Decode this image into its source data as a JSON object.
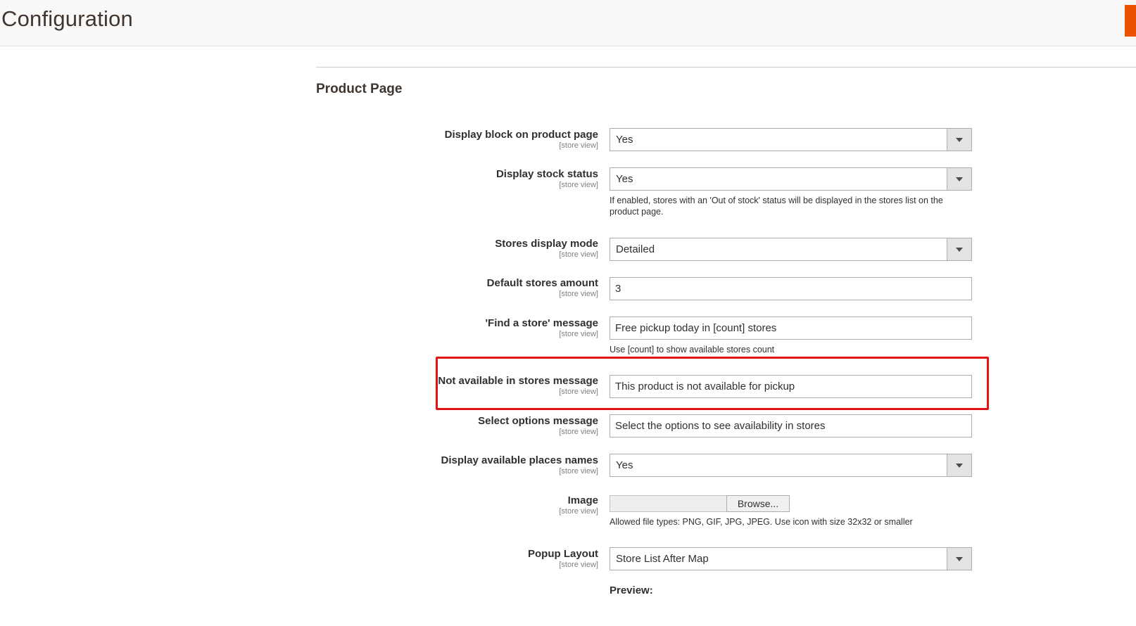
{
  "page": {
    "title": "Configuration"
  },
  "section": {
    "title": "Product Page"
  },
  "scope_text": "[store view]",
  "fields": {
    "display_block": {
      "label": "Display block on product page",
      "value": "Yes"
    },
    "display_stock": {
      "label": "Display stock status",
      "value": "Yes",
      "note": "If enabled, stores with an 'Out of stock' status will be displayed in the stores list on the product page."
    },
    "display_mode": {
      "label": "Stores display mode",
      "value": "Detailed"
    },
    "default_amount": {
      "label": "Default stores amount",
      "value": "3"
    },
    "find_store_msg": {
      "label": "'Find a store' message",
      "value": "Free pickup today in [count] stores",
      "note": "Use [count] to show available stores count"
    },
    "not_available_msg": {
      "label": "Not available in stores message",
      "value": "This product is not available for pickup"
    },
    "select_options_msg": {
      "label": "Select options message",
      "value": "Select the options to see availability in stores"
    },
    "display_places": {
      "label": "Display available places names",
      "value": "Yes"
    },
    "image": {
      "label": "Image",
      "button": "Browse...",
      "note": "Allowed file types: PNG, GIF, JPG, JPEG. Use icon with size 32x32 or smaller"
    },
    "popup_layout": {
      "label": "Popup Layout",
      "value": "Store List After Map"
    }
  },
  "preview_label": "Preview:",
  "colors": {
    "accent": "#eb5202",
    "highlight": "#e01212",
    "title": "#41362f"
  }
}
